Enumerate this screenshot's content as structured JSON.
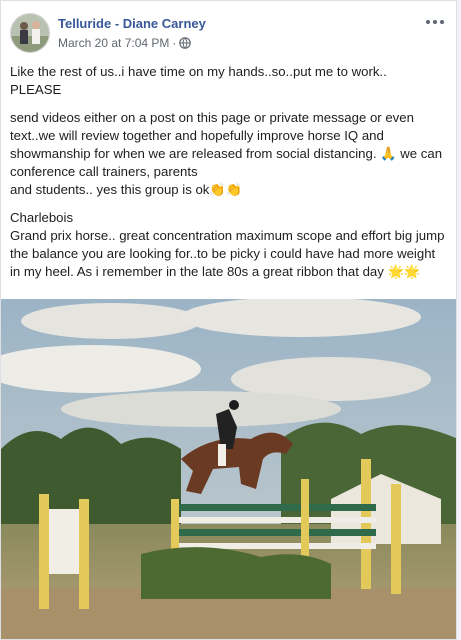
{
  "post": {
    "author": "Telluride - Diane Carney",
    "timestamp": "March 20 at 7:04 PM",
    "separator": "·",
    "paragraphs": [
      "Like the rest of us..i have time on my hands..so..put me to work..\nPLEASE",
      "send videos either on a post on this page or private message or even text..we will review together and hopefully improve horse IQ and showmanship for when we are released from social distancing. 🙏 we can conference call trainers, parents\nand students.. yes this group is ok👏👏",
      "Charlebois\nGrand prix horse.. great concentration maximum scope and effort big jump the balance you are looking for..to be picky i could have had more weight in my heel. As i remember in the late 80s a great ribbon that day 🌟🌟"
    ]
  },
  "icons": {
    "privacy": "globe-icon",
    "menu": "more-options-icon"
  },
  "colors": {
    "author_link": "#385898",
    "meta_text": "#606770",
    "card_border": "#dddfe2"
  }
}
